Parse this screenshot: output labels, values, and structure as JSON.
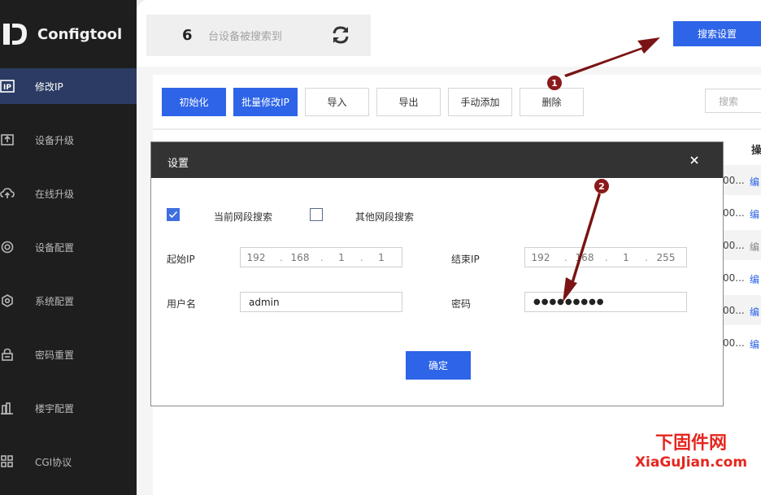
{
  "app": {
    "name": "Configtool"
  },
  "sidebar": {
    "items": [
      {
        "label": "修改IP",
        "icon": "ip-icon",
        "active": true
      },
      {
        "label": "设备升级",
        "icon": "upload-icon",
        "active": false
      },
      {
        "label": "在线升级",
        "icon": "cloud-upload-icon",
        "active": false
      },
      {
        "label": "设备配置",
        "icon": "target-icon",
        "active": false
      },
      {
        "label": "系统配置",
        "icon": "hexagon-gear-icon",
        "active": false
      },
      {
        "label": "密码重置",
        "icon": "lock-icon",
        "active": false
      },
      {
        "label": "楼宇配置",
        "icon": "building-icon",
        "active": false
      },
      {
        "label": "CGI协议",
        "icon": "grid-icon",
        "active": false
      }
    ]
  },
  "header": {
    "device_count": "6",
    "device_count_text": "台设备被搜索到",
    "search_settings_label": "搜索设置"
  },
  "toolbar": {
    "init_label": "初始化",
    "batch_modify_label": "批量修改IP",
    "import_label": "导入",
    "export_label": "导出",
    "manual_add_label": "手动添加",
    "delete_label": "删除",
    "search_placeholder": "搜索"
  },
  "table": {
    "header_partial": "操",
    "rows": [
      {
        "cell": "00...",
        "action": "编"
      },
      {
        "cell": "00...",
        "action": "编"
      },
      {
        "cell": "00...",
        "action": "编"
      },
      {
        "cell": "00...",
        "action": "编"
      },
      {
        "cell": "00...",
        "action": "编"
      },
      {
        "cell": "00...",
        "action": "编"
      }
    ]
  },
  "dialog": {
    "title": "设置",
    "current_segment_label": "当前网段搜索",
    "current_segment_checked": true,
    "other_segment_label": "其他网段搜索",
    "other_segment_checked": false,
    "start_ip_label": "起始IP",
    "start_ip": [
      "192",
      "168",
      "1",
      "1"
    ],
    "end_ip_label": "结束IP",
    "end_ip": [
      "192",
      "168",
      "1",
      "255"
    ],
    "username_label": "用户名",
    "username_value": "admin",
    "password_label": "密码",
    "password_value": "●●●●●●●●●",
    "confirm_label": "确定"
  },
  "annotations": {
    "badge_1": "1",
    "badge_2": "2",
    "arrow_color": "#7a1414"
  },
  "watermark": {
    "line1": "下固件网",
    "line2": "XiaGuJian.com"
  },
  "colors": {
    "primary": "#2d64e8",
    "sidebar_bg": "#1e1e1e",
    "sidebar_active": "#2b3b63",
    "dialog_header": "#333333"
  }
}
